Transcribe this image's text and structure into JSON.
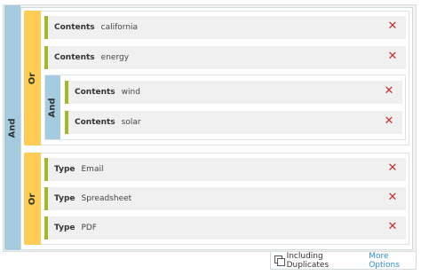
{
  "operators": {
    "root": "And",
    "group1": "Or",
    "nested": "And",
    "group2": "Or"
  },
  "group1": {
    "rows": [
      {
        "field": "Contents",
        "value": "california"
      },
      {
        "field": "Contents",
        "value": "energy"
      }
    ],
    "nested_rows": [
      {
        "field": "Contents",
        "value": "wind"
      },
      {
        "field": "Contents",
        "value": "solar"
      }
    ]
  },
  "group2": {
    "rows": [
      {
        "field": "Type",
        "value": "Email"
      },
      {
        "field": "Type",
        "value": "Spreadsheet"
      },
      {
        "field": "Type",
        "value": "PDF"
      }
    ]
  },
  "delete_glyph": "✕",
  "footer": {
    "duplicates_label": "Including Duplicates",
    "more_options_label": "More Options"
  },
  "colors": {
    "and_tab": "#a5cbe0",
    "or_tab": "#ffcc55",
    "row_accent": "#a0b829",
    "delete": "#c4312c",
    "link": "#2f8fd0"
  }
}
